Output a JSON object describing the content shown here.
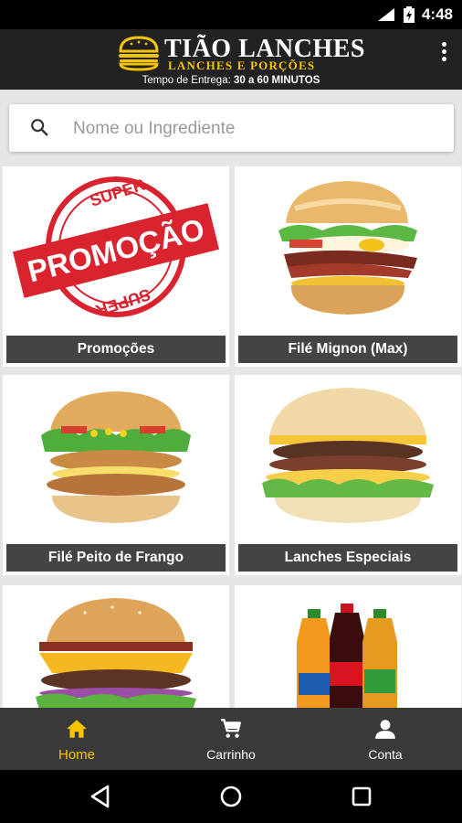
{
  "status_bar": {
    "network": "4G",
    "time": "4:48"
  },
  "header": {
    "brand": "TIÃO LANCHES",
    "tagline": "LANCHES E PORÇÕES",
    "delivery_prefix": "Tempo de Entrega:",
    "delivery_value": "30 a 60 MINUTOS"
  },
  "search": {
    "placeholder": "Nome ou Ingrediente",
    "value": ""
  },
  "categories": [
    {
      "label": "Promoções",
      "stamp_top": "SUPER",
      "stamp_main": "PROMOÇÃO",
      "stamp_bottom": "SUPER"
    },
    {
      "label": "Filé Mignon (Max)"
    },
    {
      "label": "Filé Peito de Frango"
    },
    {
      "label": "Lanches Especiais"
    },
    {
      "label": ""
    },
    {
      "label": ""
    }
  ],
  "bottom_nav": [
    {
      "label": "Home",
      "icon": "home-icon",
      "active": true
    },
    {
      "label": "Carrinho",
      "icon": "cart-icon",
      "active": false
    },
    {
      "label": "Conta",
      "icon": "account-icon",
      "active": false
    }
  ],
  "colors": {
    "accent": "#f5c400",
    "appbar": "#222222",
    "label_bg": "#444444",
    "bottom_nav": "#3a3a3a"
  }
}
